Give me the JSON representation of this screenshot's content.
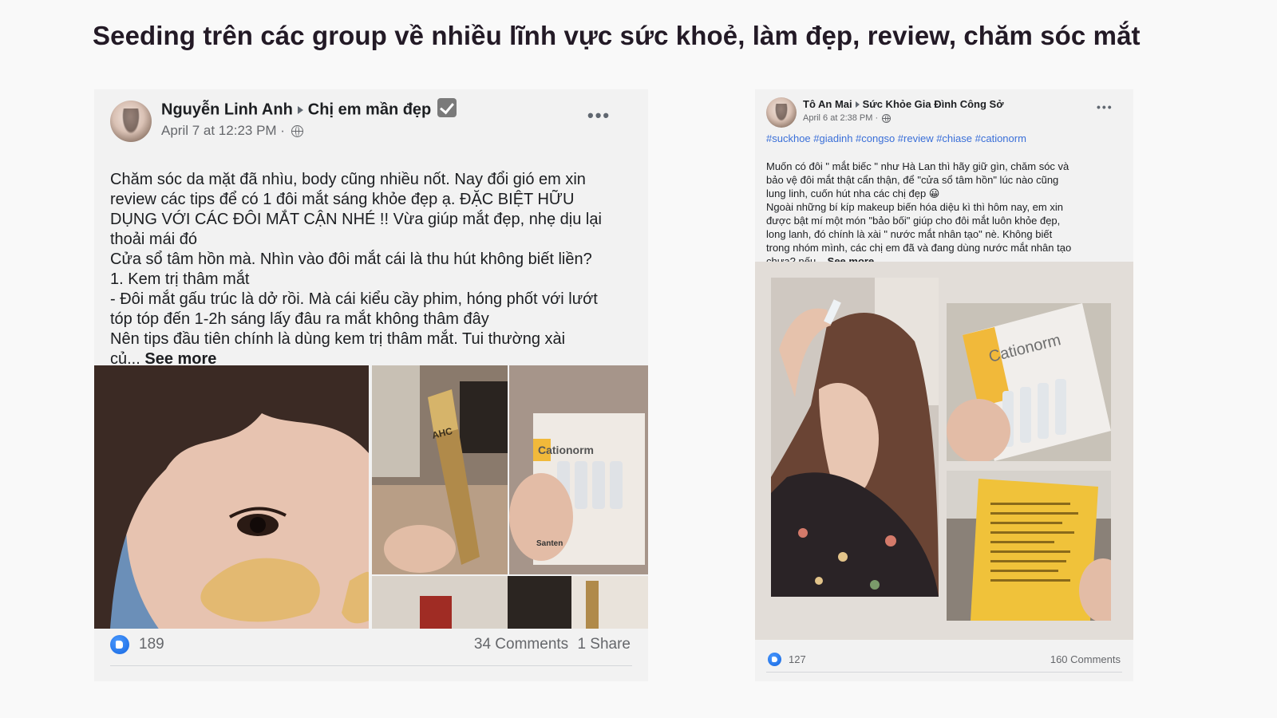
{
  "slide_title": "Seeding trên các group về nhiều lĩnh vực sức khoẻ, làm đẹp, review, chăm sóc mắt",
  "post1": {
    "author": "Nguyễn Linh Anh",
    "group": "Chị em mần đẹp",
    "timestamp": "April 7 at 12:23 PM ·",
    "body": "Chăm sóc da mặt đã nhìu, body cũng nhiều nốt. Nay đổi gió em xin\nreview các tips để có 1 đôi mắt sáng khỏe đẹp ạ. ĐẶC BIỆT HỮU\nDỤNG VỚI CÁC ĐÔI MẮT CẬN NHÉ !! Vừa giúp mắt đẹp, nhẹ dịu lại\nthoải mái đó\nCửa sổ tâm hồn mà. Nhìn vào đôi mắt cái là thu hút không biết liền?\n1. Kem trị thâm mắt\n- Đôi mắt gấu trúc là dở rồi. Mà cái kiểu cầy phim, hóng phốt với lướt\ntóp tóp đến 1-2h sáng lấy đâu ra mắt không thâm đây\nNên tips đầu tiên chính là dùng kem trị thâm mắt. Tui thường xài\ncủ...",
    "see_more": "See more",
    "photo_labels": {
      "tube_brand": "AHC",
      "box_brand": "Cationorm",
      "maker": "Santen"
    },
    "likes": "189",
    "comments": "34 Comments",
    "shares": "1 Share"
  },
  "post2": {
    "author": "Tô An Mai",
    "group": "Sức Khỏe Gia Đình Công Sở",
    "timestamp": "April 6 at 2:38 PM ·",
    "hashtags": "#suckhoe #giadinh #congso #review #chiase #cationorm",
    "body": "Muốn có đôi \" mắt biếc \" như Hà Lan thì hãy giữ gìn, chăm sóc và\nbảo vệ đôi mắt thật cẩn thận, để \"cửa sổ tâm hồn\" lúc nào cũng\nlung linh, cuốn hút nha các chị đẹp 😀\nNgoài những bí kíp makeup biến hóa diệu kì thì hôm nay, em xin\nđược bật mí một món \"bảo bối\" giúp cho đôi mắt luôn khỏe đẹp,\nlong lanh, đó chính là xài \" nước mắt nhân tạo\" nè. Không biết\ntrong nhóm mình, các chị em đã và đang dùng nước mắt nhân tạo\nchưa? nếu...",
    "see_more": "See more",
    "photo_labels": {
      "box_brand": "Cationorm"
    },
    "likes": "127",
    "comments": "160 Comments"
  },
  "icons": [
    "like-icon",
    "globe-icon",
    "more-options-icon",
    "verified-check-icon",
    "caret-right-icon"
  ],
  "colors": {
    "title": "#231a26",
    "link_blue": "#3a6fd8",
    "like_blue": "#1877f2",
    "meta_gray": "#65676b"
  }
}
